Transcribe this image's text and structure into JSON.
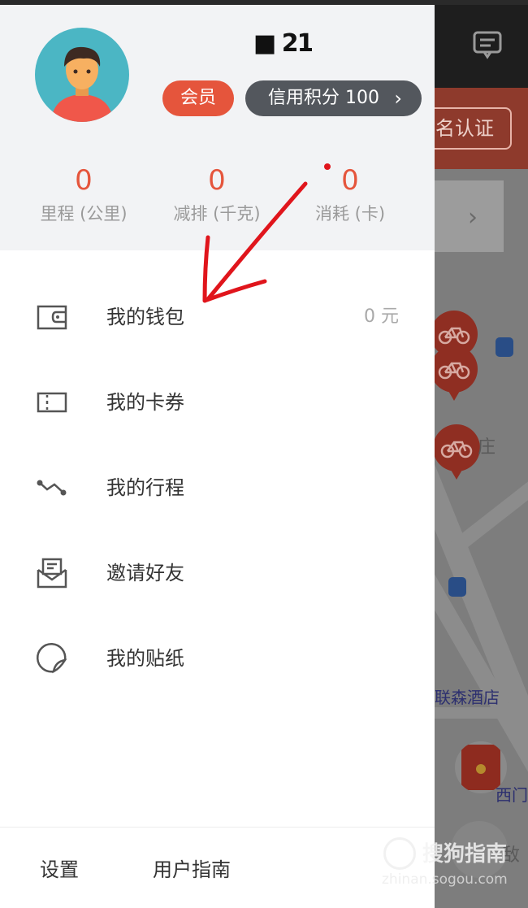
{
  "profile": {
    "username": "■ 21",
    "member_label": "会员",
    "credit_label": "信用积分 100",
    "credit_chevron": "›"
  },
  "stats": [
    {
      "value": "0",
      "label": "里程 (公里)"
    },
    {
      "value": "0",
      "label": "减排 (千克)"
    },
    {
      "value": "0",
      "label": "消耗 (卡)"
    }
  ],
  "menu": [
    {
      "label": "我的钱包",
      "value": "0 元",
      "icon": "wallet-icon"
    },
    {
      "label": "我的卡券",
      "icon": "coupon-icon"
    },
    {
      "label": "我的行程",
      "icon": "route-icon"
    },
    {
      "label": "邀请好友",
      "icon": "invite-icon"
    },
    {
      "label": "我的贴纸",
      "icon": "sticker-icon"
    }
  ],
  "footer": {
    "settings_label": "设置",
    "guide_label": "用户指南"
  },
  "map": {
    "verify_label": "名认证",
    "chevron": "›",
    "labels": {
      "poi_partial": "庄",
      "hotel": "联森酒店",
      "west_gate": "西门",
      "gate_partial": "敌"
    }
  },
  "watermark": {
    "brand": "搜狗指南",
    "url": "zhinan.sogou.com"
  },
  "colors": {
    "accent": "#e5553c",
    "badge_dark": "#53575d",
    "annotation": "#e0151c"
  }
}
